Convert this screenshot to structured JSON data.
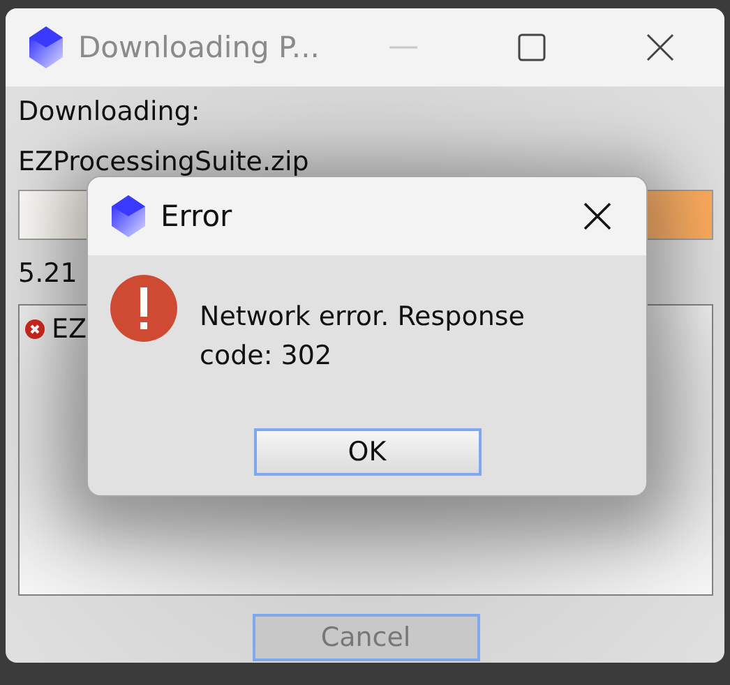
{
  "window": {
    "title": "Downloading P...",
    "controls": [
      {
        "kind": "minimize",
        "disabled": true
      },
      {
        "kind": "maximize",
        "disabled": false
      },
      {
        "kind": "close",
        "disabled": false
      }
    ]
  },
  "label": "Downloading:",
  "file_name": "EZProcessingSuite.zip",
  "progress": {
    "level": 1
  },
  "status": "5.21",
  "log": [
    {
      "kind": "error",
      "text": "EZ"
    }
  ],
  "cancel_button": {
    "label": "Cancel",
    "disabled": true
  },
  "dialog": {
    "title": "Error",
    "message": "Network error. Response code: 302",
    "ok_button": "OK"
  }
}
